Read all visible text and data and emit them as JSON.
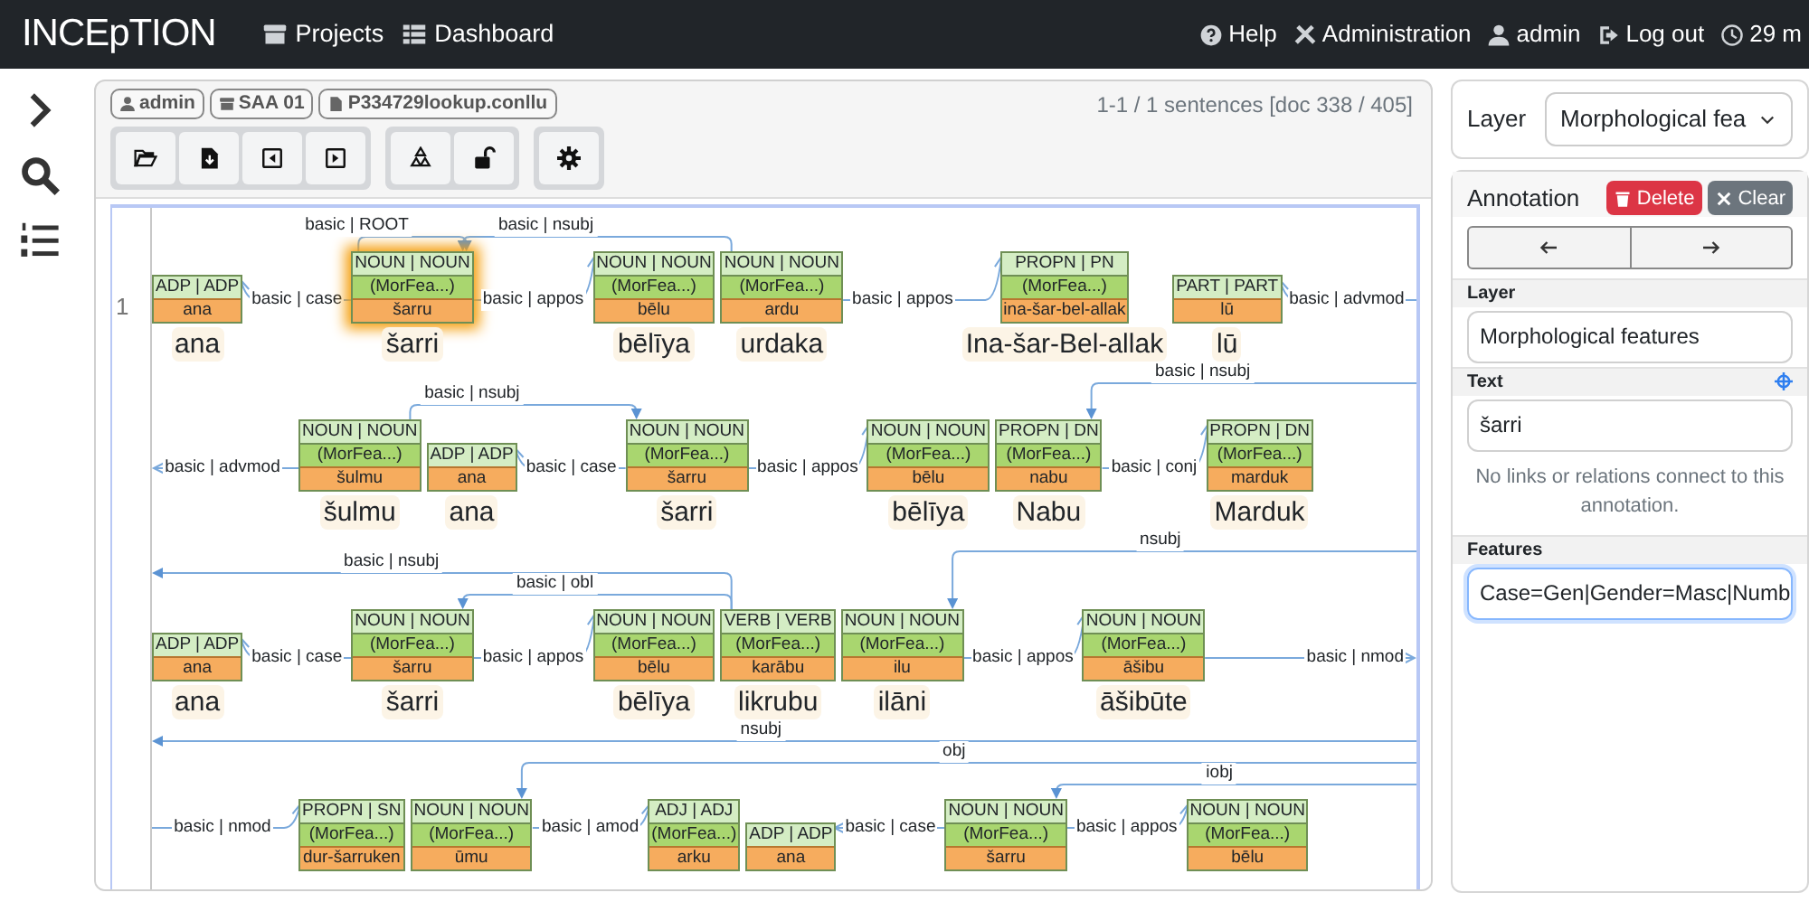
{
  "navbar": {
    "brand": "INCEpTION",
    "links": [
      {
        "kind": "projects",
        "label": "Projects"
      },
      {
        "kind": "dashboard",
        "label": "Dashboard"
      }
    ],
    "right": [
      {
        "kind": "help",
        "label": "Help"
      },
      {
        "kind": "admin",
        "label": "Administration"
      },
      {
        "kind": "user",
        "label": "admin"
      },
      {
        "kind": "logout",
        "label": "Log out"
      },
      {
        "kind": "timer",
        "label": "29 m"
      }
    ]
  },
  "editor": {
    "badges": [
      {
        "kind": "user",
        "label": "admin"
      },
      {
        "kind": "project",
        "label": "SAA 01"
      },
      {
        "kind": "file",
        "label": "P334729lookup.conllu"
      }
    ],
    "status": "1-1 / 1 sentences [doc 338 / 405]",
    "rows": [
      {
        "number": "1",
        "lanes": [
          [
            "basic | ROOT",
            "basic | nsubj"
          ]
        ],
        "items": [
          {
            "kind": "token",
            "pos": "ADP | ADP",
            "lemma": "ana",
            "word": "ana",
            "selected": false
          },
          {
            "kind": "link",
            "label": "basic | case",
            "points_left": true
          },
          {
            "kind": "token",
            "pos": "NOUN | NOUN",
            "features": "(MorFea...)",
            "lemma": "šarru",
            "word": "šarri",
            "selected": true
          },
          {
            "kind": "link",
            "label": "basic | appos",
            "points_left": false
          },
          {
            "kind": "token",
            "pos": "NOUN | NOUN",
            "features": "(MorFea...)",
            "lemma": "bēlu",
            "word": "bēlīya",
            "selected": false
          },
          {
            "kind": "token",
            "pos": "NOUN | NOUN",
            "features": "(MorFea...)",
            "lemma": "ardu",
            "word": "urdaka",
            "selected": false
          },
          {
            "kind": "link",
            "label": "basic | appos",
            "points_left": false
          },
          {
            "kind": "token",
            "pos": "PROPN | PN",
            "features": "(MorFea...)",
            "lemma": "ina-šar-bel-allak",
            "word": "Ina-šar-Bel-allak",
            "selected": false
          },
          {
            "kind": "token",
            "pos": "PART | PART",
            "lemma": "lū",
            "word": "lū",
            "selected": false
          },
          {
            "kind": "tail",
            "label": "basic | advmod",
            "points_left": true
          }
        ]
      },
      {
        "lanes": [
          [
            "basic | nsubj"
          ],
          [
            "basic | nsubj"
          ]
        ],
        "items": [
          {
            "kind": "lead",
            "label": "basic | advmod",
            "points_left": true
          },
          {
            "kind": "token",
            "pos": "NOUN | NOUN",
            "features": "(MorFea...)",
            "lemma": "šulmu",
            "word": "šulmu",
            "selected": false
          },
          {
            "kind": "token",
            "pos": "ADP | ADP",
            "lemma": "ana",
            "word": "ana",
            "selected": false
          },
          {
            "kind": "link",
            "label": "basic | case",
            "points_left": true
          },
          {
            "kind": "token",
            "pos": "NOUN | NOUN",
            "features": "(MorFea...)",
            "lemma": "šarru",
            "word": "šarri",
            "selected": false
          },
          {
            "kind": "link",
            "label": "basic | appos",
            "points_left": false
          },
          {
            "kind": "token",
            "pos": "NOUN | NOUN",
            "features": "(MorFea...)",
            "lemma": "bēlu",
            "word": "bēlīya",
            "selected": false
          },
          {
            "kind": "token",
            "pos": "PROPN | DN",
            "features": "(MorFea...)",
            "lemma": "nabu",
            "word": "Nabu",
            "selected": false
          },
          {
            "kind": "link",
            "label": "basic | conj",
            "points_left": false
          },
          {
            "kind": "token",
            "pos": "PROPN | DN",
            "features": "(MorFea...)",
            "lemma": "marduk",
            "word": "Marduk",
            "selected": false
          }
        ]
      },
      {
        "lanes": [
          [
            "basic | obl"
          ],
          [
            "basic | nsubj"
          ],
          [
            "nsubj"
          ]
        ],
        "items": [
          {
            "kind": "token",
            "pos": "ADP | ADP",
            "lemma": "ana",
            "word": "ana",
            "selected": false
          },
          {
            "kind": "link",
            "label": "basic | case",
            "points_left": true
          },
          {
            "kind": "token",
            "pos": "NOUN | NOUN",
            "features": "(MorFea...)",
            "lemma": "šarru",
            "word": "šarri",
            "selected": false
          },
          {
            "kind": "link",
            "label": "basic | appos",
            "points_left": false
          },
          {
            "kind": "token",
            "pos": "NOUN | NOUN",
            "features": "(MorFea...)",
            "lemma": "bēlu",
            "word": "bēlīya",
            "selected": false
          },
          {
            "kind": "token",
            "pos": "VERB | VERB",
            "features": "(MorFea...)",
            "lemma": "karābu",
            "word": "likrubu",
            "selected": false
          },
          {
            "kind": "token",
            "pos": "NOUN | NOUN",
            "features": "(MorFea...)",
            "lemma": "ilu",
            "word": "ilāni",
            "selected": false
          },
          {
            "kind": "link",
            "label": "basic | appos",
            "points_left": false
          },
          {
            "kind": "token",
            "pos": "NOUN | NOUN",
            "features": "(MorFea...)",
            "lemma": "āšibu",
            "word": "āšibūte",
            "selected": false
          },
          {
            "kind": "tail",
            "label": "basic | nmod",
            "points_left": false
          }
        ]
      },
      {
        "lanes": [
          [
            "iobj"
          ],
          [
            "obj"
          ],
          [
            "nsubj"
          ]
        ],
        "items": [
          {
            "kind": "lead",
            "label": "basic | nmod",
            "points_left": false
          },
          {
            "kind": "token",
            "pos": "PROPN | SN",
            "features": "(MorFea...)",
            "lemma": "dur-šarruken",
            "selected": false
          },
          {
            "kind": "token",
            "pos": "NOUN | NOUN",
            "features": "(MorFea...)",
            "lemma": "ūmu",
            "selected": false
          },
          {
            "kind": "link",
            "label": "basic | amod",
            "points_left": false
          },
          {
            "kind": "token",
            "pos": "ADJ | ADJ",
            "features": "(MorFea...)",
            "lemma": "arku",
            "selected": false
          },
          {
            "kind": "token",
            "pos": "ADP | ADP",
            "lemma": "ana",
            "selected": false
          },
          {
            "kind": "link",
            "label": "basic | case",
            "points_left": true
          },
          {
            "kind": "token",
            "pos": "NOUN | NOUN",
            "features": "(MorFea...)",
            "lemma": "šarru",
            "selected": false
          },
          {
            "kind": "link",
            "label": "basic | appos",
            "points_left": false
          },
          {
            "kind": "token",
            "pos": "NOUN | NOUN",
            "features": "(MorFea...)",
            "lemma": "bēlu",
            "selected": false
          }
        ]
      }
    ]
  },
  "layer_select": {
    "label": "Layer",
    "value": "Morphological fea"
  },
  "annotation": {
    "title": "Annotation",
    "buttons": [
      {
        "kind": "delete",
        "label": "Delete"
      },
      {
        "kind": "clear",
        "label": "Clear"
      }
    ],
    "layer_field": {
      "label": "Layer",
      "value": "Morphological features"
    },
    "text_field": {
      "label": "Text",
      "value": "šarri"
    },
    "note": "No links or relations connect to this annotation.",
    "features_field": {
      "label": "Features",
      "value": "Case=Gen|Gender=Masc|Numb",
      "focused": true
    }
  }
}
